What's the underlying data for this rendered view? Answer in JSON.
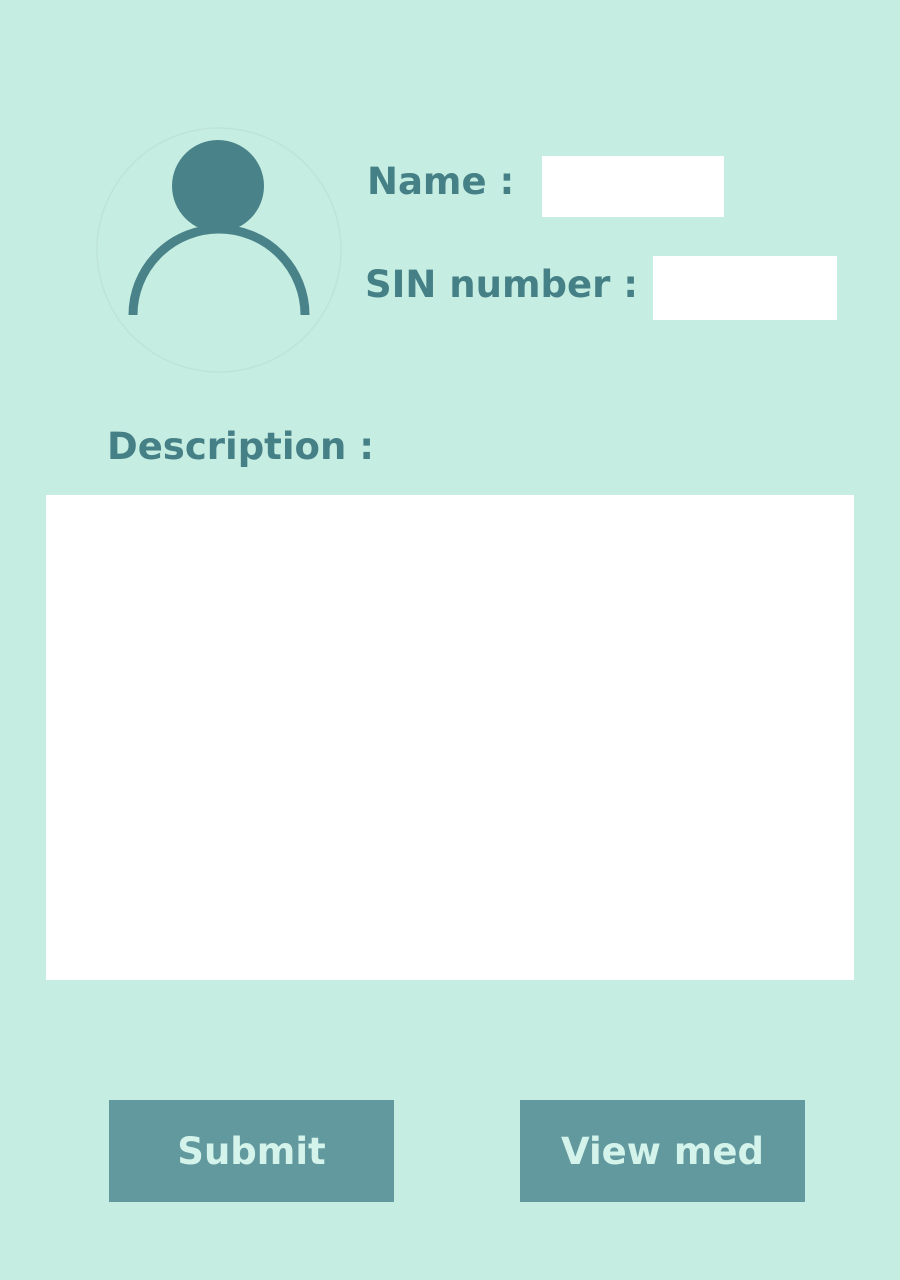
{
  "profile": {
    "avatar_icon": "user-avatar-icon",
    "accent_color": "#468087"
  },
  "form": {
    "name_label": "Name :",
    "name_value": "",
    "sin_label": "SIN number :",
    "sin_value": "",
    "description_label": "Description :",
    "description_value": ""
  },
  "actions": {
    "submit_label": "Submit",
    "view_med_label": "View med",
    "button_color": "#62999e"
  },
  "theme": {
    "background": "#c6ede2",
    "field_background": "#ffffff"
  }
}
